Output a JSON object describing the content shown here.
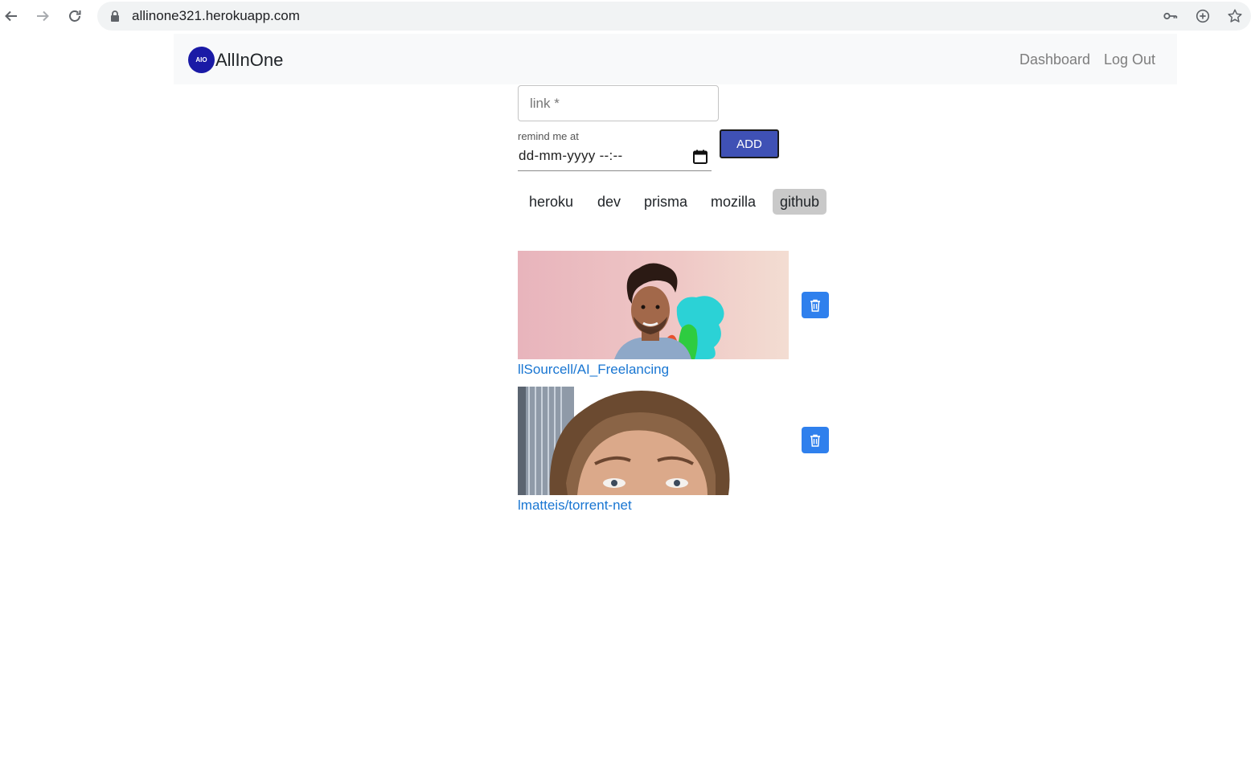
{
  "browser": {
    "url": "allinone321.herokuapp.com",
    "icons": [
      "back-arrow-icon",
      "forward-arrow-icon",
      "reload-icon",
      "lock-icon",
      "key-icon",
      "add-circle-icon",
      "star-icon"
    ]
  },
  "navbar": {
    "logo_text": "AIO",
    "brand": "AllInOne",
    "links": [
      "Dashboard",
      "Log Out"
    ]
  },
  "form": {
    "link_placeholder": "link *",
    "remind_label": "remind me at",
    "date_placeholder": "dd-mm-yyyy --:--",
    "add_label": "ADD"
  },
  "tags": [
    {
      "label": "heroku",
      "active": false
    },
    {
      "label": "dev",
      "active": false
    },
    {
      "label": "prisma",
      "active": false
    },
    {
      "label": "mozilla",
      "active": false
    },
    {
      "label": "github",
      "active": true
    }
  ],
  "items": [
    {
      "title": "llSourcell/AI_Freelancing"
    },
    {
      "title": "lmatteis/torrent-net"
    }
  ],
  "colors": {
    "accent": "#3f51b5",
    "link": "#1976d2",
    "delete": "#2f80ed",
    "logo": "#1a1aa6",
    "tag_active": "#c9c9c9"
  }
}
